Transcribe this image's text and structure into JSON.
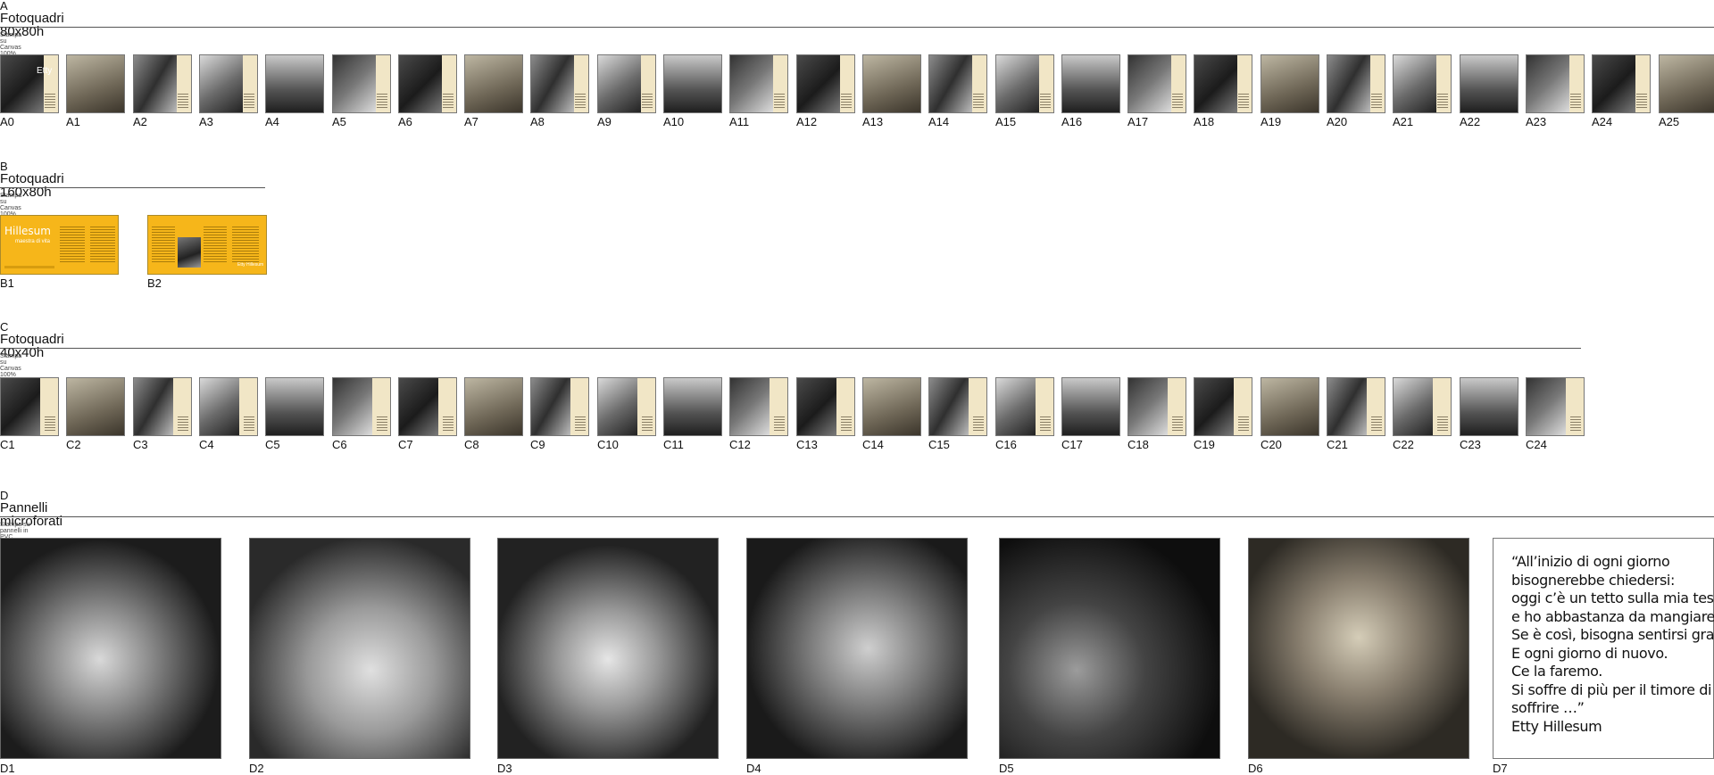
{
  "sections": [
    {
      "letter": "A",
      "title": "Fotoquadri 80x80h",
      "subtitle": "Stampa su Canvas 100% naturale intelaiata."
    },
    {
      "letter": "B",
      "title": "Fotoquadri 160x80h",
      "subtitle": "Stampa su Canvas 100% naturale intelaiata."
    },
    {
      "letter": "C",
      "title": "Fotoquadri 40x40h",
      "subtitle": "Stampa su Canvas 100% naturale intelaiata."
    },
    {
      "letter": "D",
      "title": "Pannelli microforati",
      "subtitle": "Stampa su pannelli in PVC microforato."
    }
  ],
  "a_items": [
    "A0",
    "A1",
    "A2",
    "A3",
    "A4",
    "A5",
    "A6",
    "A7",
    "A8",
    "A9",
    "A10",
    "A11",
    "A12",
    "A13",
    "A14",
    "A15",
    "A16",
    "A17",
    "A18",
    "A19",
    "A20",
    "A21",
    "A22",
    "A23",
    "A24",
    "A25"
  ],
  "a0_overlay": "Etty",
  "b_items": [
    "B1",
    "B2"
  ],
  "b1_title": "Hillesum",
  "b1_subtitle": "maestra di vita",
  "b2_title": "Etty Hillesum",
  "c_items": [
    "C1",
    "C2",
    "C3",
    "C4",
    "C5",
    "C6",
    "C7",
    "C8",
    "C9",
    "C10",
    "C11",
    "C12",
    "C13",
    "C14",
    "C15",
    "C16",
    "C17",
    "C18",
    "C19",
    "C20",
    "C21",
    "C22",
    "C23",
    "C24"
  ],
  "d_items": [
    "D1",
    "D2",
    "D3",
    "D4",
    "D5",
    "D6",
    "D7"
  ],
  "quote": {
    "lines": [
      "“All’inizio di ogni giorno",
      "bisognerebbe chiedersi:",
      "oggi c’è un tetto sulla mia testa",
      "e ho abbastanza da mangiare ?",
      "Se è così, bisogna sentirsi grati.",
      "E ogni giorno di nuovo.",
      "Ce la faremo.",
      "Si soffre di più per il timore di",
      "soffrire …”",
      "Etty Hillesum"
    ]
  },
  "colors": {
    "panel_yellow": "#f6b61a",
    "caption_bg": "#f1e6c6",
    "rule": "#555555"
  }
}
